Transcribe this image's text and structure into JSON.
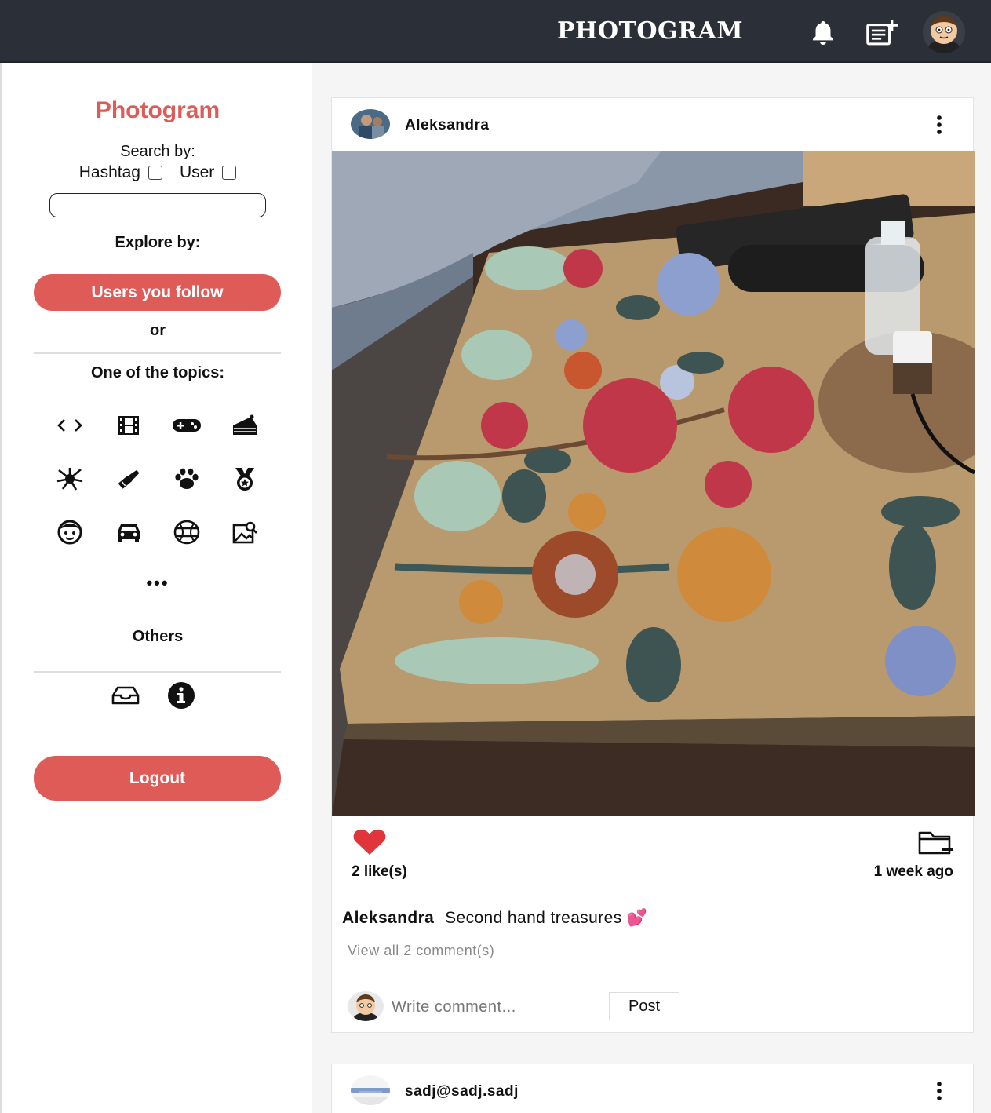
{
  "header": {
    "brand": "PHOTOGRAM"
  },
  "sidebar": {
    "title": "Photogram",
    "search_by_label": "Search by:",
    "hashtag_label": "Hashtag",
    "user_label": "User",
    "search_value": "",
    "explore_by_label": "Explore by:",
    "users_you_follow": "Users you follow",
    "or_label": "or",
    "topics_label": "One of the topics:",
    "topics": [
      "code-icon",
      "film-icon",
      "gamepad-icon",
      "cake-icon",
      "splash-icon",
      "lipstick-icon",
      "paw-icon",
      "medal-icon",
      "face-icon",
      "car-icon",
      "globe-icon",
      "image-search-icon"
    ],
    "more_label": "•••",
    "others_label": "Others",
    "logout_label": "Logout"
  },
  "posts": [
    {
      "username": "Aleksandra",
      "likes": "2 like(s)",
      "time_ago": "1 week ago",
      "caption_user": "Aleksandra",
      "caption_text": "Second hand treasures 💕",
      "view_comments": "View all 2 comment(s)",
      "comment_placeholder": "Write comment...",
      "post_button": "Post"
    },
    {
      "username": "sadj@sadj.sadj"
    }
  ],
  "colors": {
    "accent": "#de5b57",
    "topbar": "#2b2f38",
    "heart": "#e0353a"
  }
}
